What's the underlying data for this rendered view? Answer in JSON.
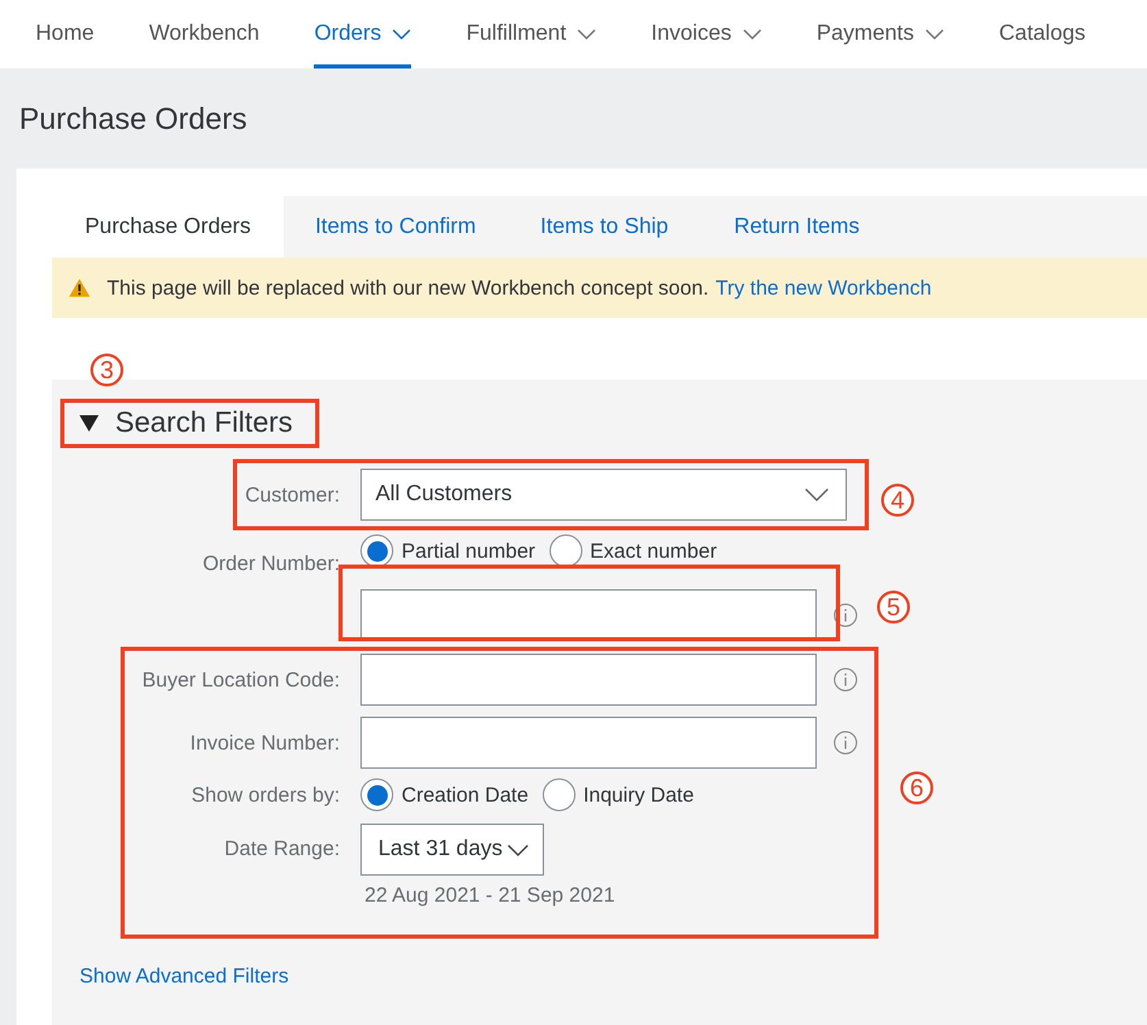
{
  "nav": [
    {
      "label": "Home",
      "selected": false,
      "dropdown": false
    },
    {
      "label": "Workbench",
      "selected": false,
      "dropdown": false
    },
    {
      "label": "Orders",
      "selected": true,
      "dropdown": true
    },
    {
      "label": "Fulfillment",
      "selected": false,
      "dropdown": true
    },
    {
      "label": "Invoices",
      "selected": false,
      "dropdown": true
    },
    {
      "label": "Payments",
      "selected": false,
      "dropdown": true
    },
    {
      "label": "Catalogs",
      "selected": false,
      "dropdown": false
    }
  ],
  "page_title": "Purchase Orders",
  "tabs": [
    {
      "label": "Purchase Orders",
      "selected": true
    },
    {
      "label": "Items to Confirm",
      "selected": false
    },
    {
      "label": "Items to Ship",
      "selected": false
    },
    {
      "label": "Return Items",
      "selected": false
    }
  ],
  "notice": {
    "text": "This page will be replaced with our new Workbench concept soon.",
    "link": "Try the new Workbench"
  },
  "filters": {
    "title": "Search Filters",
    "expanded": true,
    "fields": [
      {
        "kind": "select",
        "label": "Customer:",
        "value": "All Customers"
      },
      {
        "kind": "radio",
        "label": "Order Number:",
        "options": [
          {
            "label": "Partial number",
            "selected": true
          },
          {
            "label": "Exact number",
            "selected": false
          }
        ]
      },
      {
        "kind": "text",
        "info": true
      },
      {
        "kind": "text",
        "label": "Buyer Location Code:",
        "info": true
      },
      {
        "kind": "text",
        "label": "Invoice Number:",
        "info": true
      },
      {
        "kind": "radio",
        "label": "Show orders by:",
        "options": [
          {
            "label": "Creation Date",
            "selected": true
          },
          {
            "label": "Inquiry Date",
            "selected": false
          }
        ]
      },
      {
        "kind": "date",
        "label": "Date Range:",
        "value": "Last 31 days",
        "range": "22 Aug 2021 - 21 Sep 2021"
      }
    ],
    "advanced_link": "Show Advanced Filters"
  },
  "annotations": [
    "3",
    "4",
    "5",
    "6"
  ]
}
